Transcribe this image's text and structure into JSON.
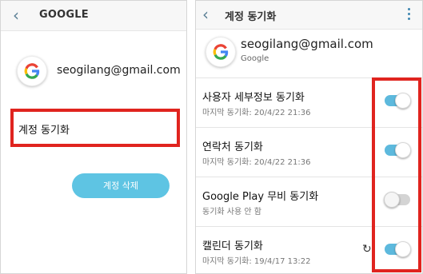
{
  "left": {
    "header": {
      "back_icon": "chevron-left-icon",
      "title": "GOOGLE"
    },
    "account": {
      "email": "seogilang@gmail.com",
      "logo": "google-g-logo"
    },
    "sync_item_label": "계정 동기화",
    "delete_button_label": "계정 삭제",
    "colors": {
      "highlight": "#e0241f",
      "button": "#5ec4e3"
    }
  },
  "right": {
    "header": {
      "back_icon": "chevron-left-icon",
      "title": "계정 동기화",
      "menu_icon": "more-vert-icon"
    },
    "account": {
      "email": "seogilang@gmail.com",
      "provider": "Google",
      "logo": "google-g-logo"
    },
    "items": [
      {
        "title": "사용자 세부정보 동기화",
        "status": "마지막 동기화: 20/4/22  21:36",
        "enabled": true,
        "syncing": false
      },
      {
        "title": "연락처 동기화",
        "status": "마지막 동기화: 20/4/22  21:36",
        "enabled": true,
        "syncing": false
      },
      {
        "title": "Google Play 무비 동기화",
        "status": "동기화 사용 안 함",
        "enabled": false,
        "syncing": false
      },
      {
        "title": "캘린더 동기화",
        "status": "마지막 동기화: 19/4/17  13:22",
        "enabled": true,
        "syncing": true
      }
    ],
    "colors": {
      "toggle_on": "#5db9dd",
      "toggle_off": "#d4d4d4",
      "highlight": "#e0241f"
    }
  }
}
